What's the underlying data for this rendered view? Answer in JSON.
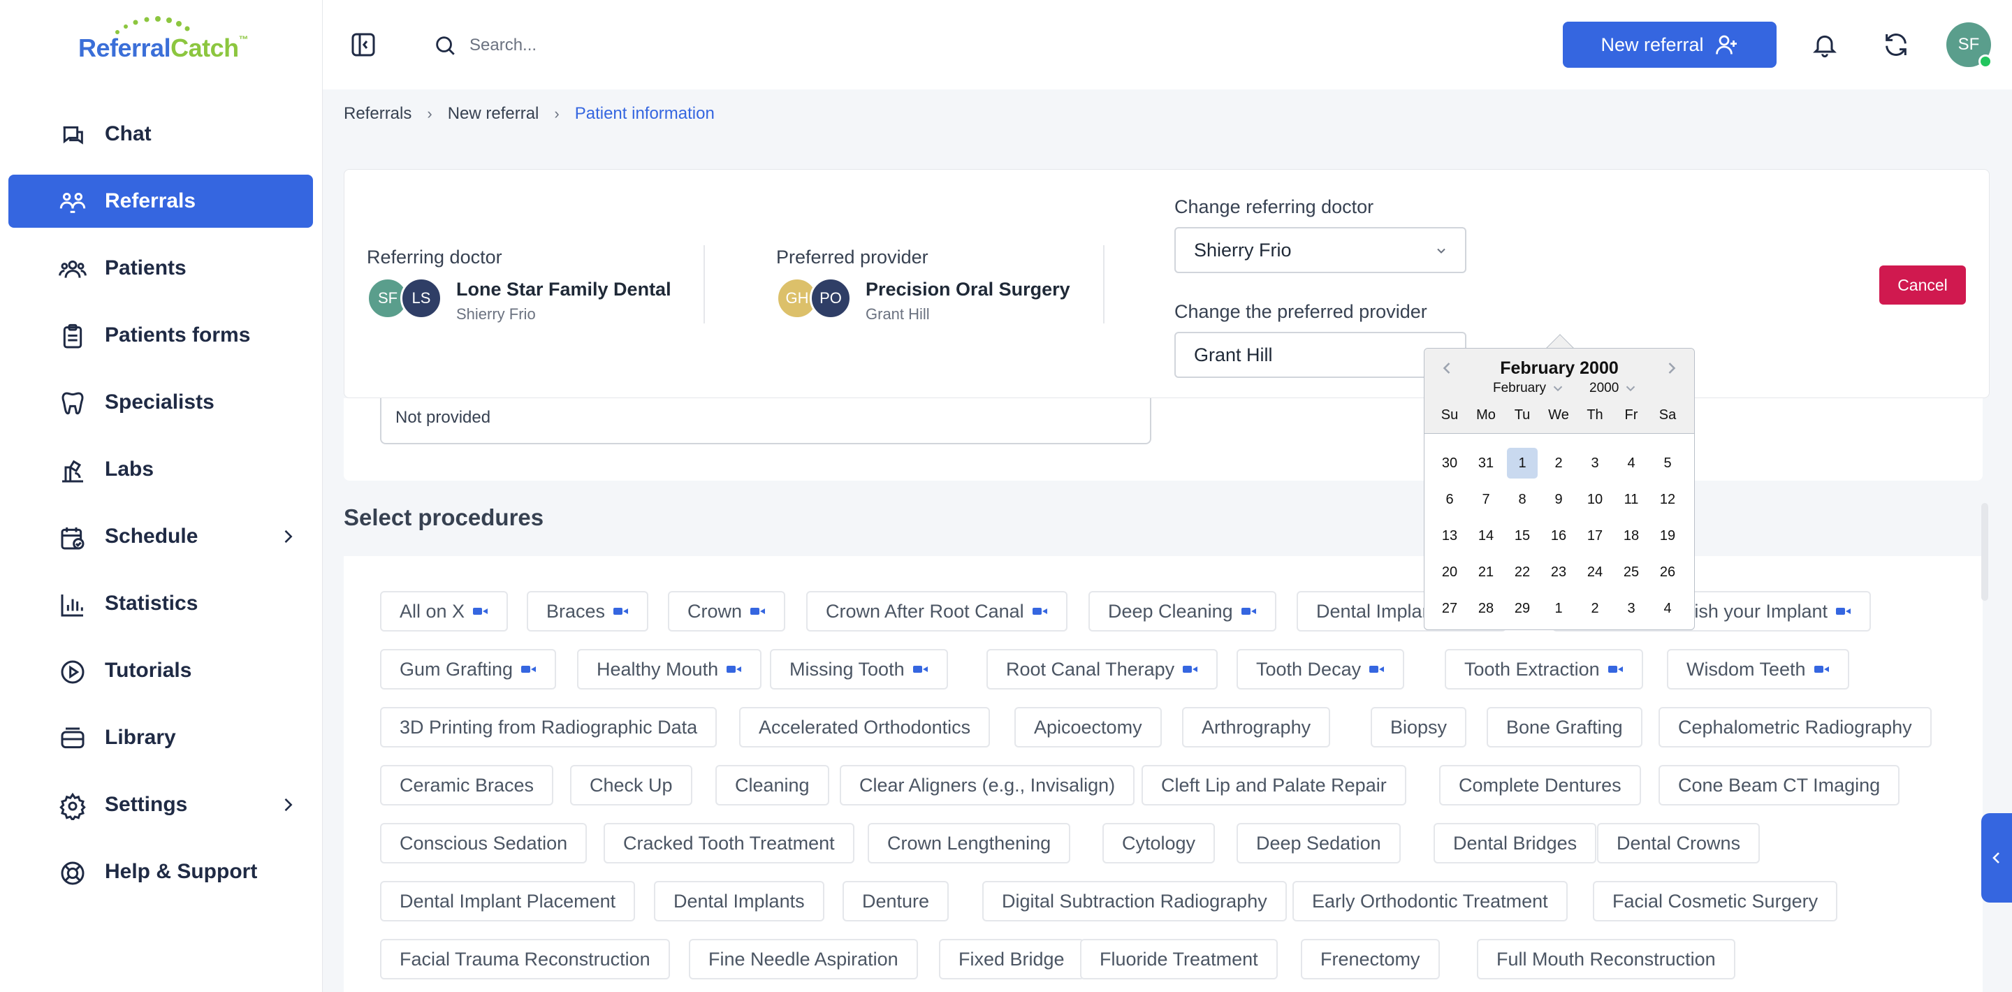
{
  "brand": {
    "logo_a": "Referral",
    "logo_b": "Catch",
    "logo_tm": "™"
  },
  "sidebar": {
    "items": [
      {
        "label": "Chat",
        "icon": "chat-icon"
      },
      {
        "label": "Referrals",
        "icon": "referrals-icon",
        "active": true
      },
      {
        "label": "Patients",
        "icon": "patients-icon"
      },
      {
        "label": "Patients forms",
        "icon": "clipboard-icon"
      },
      {
        "label": "Specialists",
        "icon": "tooth-icon"
      },
      {
        "label": "Labs",
        "icon": "labs-icon"
      },
      {
        "label": "Schedule",
        "icon": "calendar-check-icon"
      },
      {
        "label": "Statistics",
        "icon": "bar-chart-icon"
      },
      {
        "label": "Tutorials",
        "icon": "play-circle-icon"
      },
      {
        "label": "Library",
        "icon": "library-icon"
      },
      {
        "label": "Settings",
        "icon": "gear-icon"
      },
      {
        "label": "Help & Support",
        "icon": "lifebuoy-icon"
      }
    ]
  },
  "topbar": {
    "search_placeholder": "Search...",
    "new_referral_label": "New referral",
    "avatar_initials": "SF"
  },
  "breadcrumb": {
    "items": [
      "Referrals",
      "New referral"
    ],
    "current": "Patient information"
  },
  "header": {
    "referring_doctor_label": "Referring doctor",
    "referring_avatars": [
      "SF",
      "LS"
    ],
    "referring_name": "Lone Star Family Dental",
    "referring_sub": "Shierry Frio",
    "preferred_provider_label": "Preferred provider",
    "provider_avatars": [
      "GH",
      "PO"
    ],
    "provider_name": "Precision Oral Surgery",
    "provider_sub": "Grant Hill",
    "change_doctor_label": "Change referring doctor",
    "change_doctor_value": "Shierry Frio",
    "change_provider_label": "Change the preferred provider",
    "change_provider_value": "Grant Hill",
    "cancel_label": "Cancel"
  },
  "not_provided": "Not provided",
  "procedures": {
    "title": "Select procedures",
    "rows": [
      [
        "All on X",
        "Braces",
        "Crown",
        "Crown After Root Canal",
        "Deep Cleaning",
        "Dental Implant",
        "Finish your Implant"
      ],
      [
        "Gum Grafting",
        "Healthy Mouth",
        "Missing Tooth",
        "Root Canal Therapy",
        "Tooth Decay",
        "Tooth Extraction",
        "Wisdom Teeth"
      ],
      [
        "3D Printing from Radiographic Data",
        "Accelerated Orthodontics",
        "Apicoectomy",
        "Arthrography",
        "Biopsy",
        "Bone Grafting",
        "Cephalometric Radiography"
      ],
      [
        "Ceramic Braces",
        "Check Up",
        "Cleaning",
        "Clear Aligners (e.g., Invisalign)",
        "Cleft Lip and Palate Repair",
        "Complete Dentures",
        "Cone Beam CT Imaging"
      ],
      [
        "Conscious Sedation",
        "Cracked Tooth Treatment",
        "Crown Lengthening",
        "Cytology",
        "Deep Sedation",
        "Dental Bridges",
        "Dental Crowns"
      ],
      [
        "Dental Implant Placement",
        "Dental Implants",
        "Denture",
        "Digital Subtraction Radiography",
        "Early Orthodontic Treatment",
        "Facial Cosmetic Surgery"
      ],
      [
        "Facial Trauma Reconstruction",
        "Fine Needle Aspiration",
        "Fixed Bridge",
        "Fluoride Treatment",
        "Frenectomy",
        "Full Mouth Reconstruction"
      ]
    ]
  },
  "calendar": {
    "title": "February 2000",
    "month_select": "February",
    "year_select": "2000",
    "weekdays": [
      "Su",
      "Mo",
      "Tu",
      "We",
      "Th",
      "Fr",
      "Sa"
    ],
    "weeks": [
      [
        "30",
        "31",
        "1",
        "2",
        "3",
        "4",
        "5"
      ],
      [
        "6",
        "7",
        "8",
        "9",
        "10",
        "11",
        "12"
      ],
      [
        "13",
        "14",
        "15",
        "16",
        "17",
        "18",
        "19"
      ],
      [
        "20",
        "21",
        "22",
        "23",
        "24",
        "25",
        "26"
      ],
      [
        "27",
        "28",
        "29",
        "1",
        "2",
        "3",
        "4"
      ]
    ],
    "selected": "1"
  },
  "colors": {
    "primary": "#3566e0",
    "danger": "#d0194f",
    "online": "#22c55e"
  }
}
